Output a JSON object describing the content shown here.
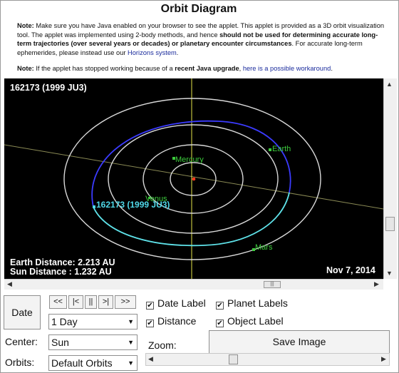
{
  "title": "Orbit Diagram",
  "note1": {
    "label": "Note:",
    "p1": " Make sure you have Java enabled on your browser to see the applet. This applet is provided as a 3D orbit visualization tool. The applet was implemented using 2-body methods, and hence ",
    "bold": "should not be used for determining accurate long-term trajectories (over several years or decades) or planetary encounter circumstances",
    "p2": ". For accurate long-term ephemerides, please instead use our ",
    "link": "Horizons system",
    "p3": "."
  },
  "note2": {
    "label": "Note:",
    "p1": " If the applet has stopped working because of a ",
    "bold": "recent Java upgrade",
    "p2": ", ",
    "link": "here is a possible workaround",
    "p3": "."
  },
  "viz": {
    "object_title": "162173 (1999 JU3)",
    "earth_distance": "Earth Distance: 2.213 AU",
    "sun_distance": "Sun Distance   : 1.232 AU",
    "date": "Nov 7, 2014",
    "labels": {
      "mercury": "Mercury",
      "venus": "Venus",
      "earth": "Earth",
      "mars": "Mars",
      "object": "162173 (1999 JU3)"
    },
    "colors": {
      "background": "#000000",
      "planet_orbit": "#d9d9d9",
      "object_orbit_near": "#3b3bff",
      "object_orbit_far": "#5fe3ea",
      "planet_label": "#3ccb3c",
      "object_label": "#4fd8e8",
      "sun": "#ff3b1f",
      "axis": "#e6e64a"
    }
  },
  "controls": {
    "date_button": "Date",
    "step_buttons": [
      "<<",
      "|<",
      "||",
      ">|",
      ">>"
    ],
    "step_select": "1 Day",
    "center_label": "Center:",
    "center_select": "Sun",
    "orbits_label": "Orbits:",
    "orbits_select": "Default Orbits",
    "zoom_label": "Zoom:",
    "save_button": "Save Image",
    "checkboxes": {
      "date_label": "Date Label",
      "planet_labels": "Planet Labels",
      "distance": "Distance",
      "object_label": "Object Label"
    },
    "checkbox_mark": "✔",
    "zoom_level_fraction": 0.34
  }
}
